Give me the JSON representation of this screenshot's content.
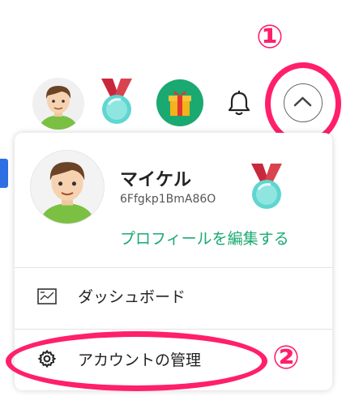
{
  "annotations": {
    "step1": "①",
    "step2": "②"
  },
  "topbar": {
    "icons": [
      "avatar",
      "medal-icon",
      "gift-icon",
      "bell-icon",
      "chevron-up-icon"
    ],
    "accent_gift": "#1aa971"
  },
  "profile": {
    "name": "マイケル",
    "user_id": "6Ffgkp1BmA86O",
    "edit_link": "プロフィールを編集する"
  },
  "menu": {
    "dashboard_label": "ダッシュボード",
    "account_label": "アカウントの管理"
  },
  "colors": {
    "annotation": "#ff1f6b",
    "link": "#1aa971",
    "medal_ribbon": "#c8283b",
    "medal_gem": "#5fd6d0"
  }
}
